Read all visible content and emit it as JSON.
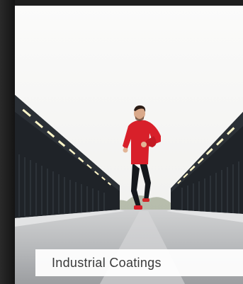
{
  "card": {
    "caption": "Industrial Coatings",
    "image_subject": "runner-on-bridge"
  },
  "colors": {
    "sky": "#f4f4f2",
    "jacket": "#d8202a",
    "bridge_dark": "#1f2328",
    "road": "#b7b9bb",
    "caption_bg": "#ffffff",
    "caption_text": "#3a3a3a"
  }
}
